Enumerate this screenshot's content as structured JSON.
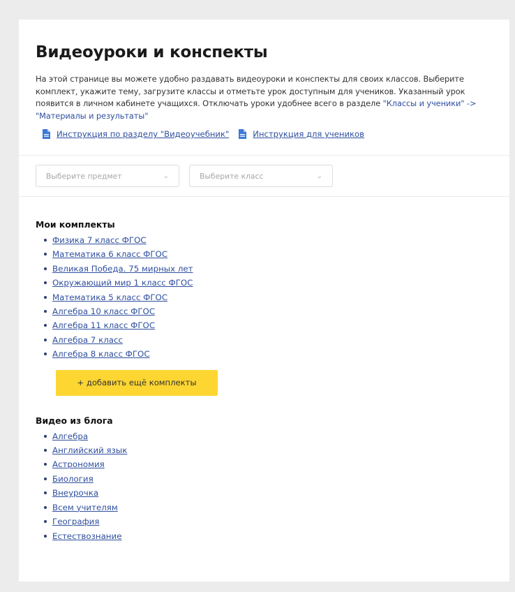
{
  "page": {
    "title": "Видеоуроки и конспекты",
    "description_parts": [
      "На этой странице вы можете удобно раздавать видеоуроки и конспекты для своих классов. Выберите комплект, укажите тему, загрузите классы и отметьте урок доступным для учеников. Указанный урок появится в личном кабинете учащихся. Отключать уроки удобнее всего в разделе ",
      "\"Классы и ученики\" -> \"Материалы и результаты\""
    ]
  },
  "docs": [
    {
      "icon": "document-icon",
      "label": "Инструкция по разделу \"Видеоучебник\""
    },
    {
      "icon": "document-icon",
      "label": "Инструкция для учеников"
    }
  ],
  "filters": {
    "subject_placeholder": "Выберите предмет",
    "class_placeholder": "Выберите класс"
  },
  "kits": {
    "heading": "Мои комплекты",
    "items": [
      "Физика 7 класс ФГОС",
      "Математика 6 класс ФГОС",
      "Великая Победа. 75 мирных лет",
      "Окружающий мир 1 класс ФГОС",
      "Математика 5 класс ФГОС",
      "Алгебра 10 класс ФГОС",
      "Алгебра 11 класс ФГОС",
      "Алгебра 7 класс",
      "Алгебра 8 класс ФГОС"
    ],
    "add_button": "+ добавить ещё комплекты"
  },
  "blog": {
    "heading": "Видео из блога",
    "items": [
      "Алгебра",
      "Английский язык",
      "Астрономия",
      "Биология",
      "Внеурочка",
      "Всем учителям",
      "География",
      "Естествознание"
    ]
  },
  "colors": {
    "link": "#2f4f9e",
    "button": "#fdd632",
    "doc_icon": "#3f78d6"
  }
}
